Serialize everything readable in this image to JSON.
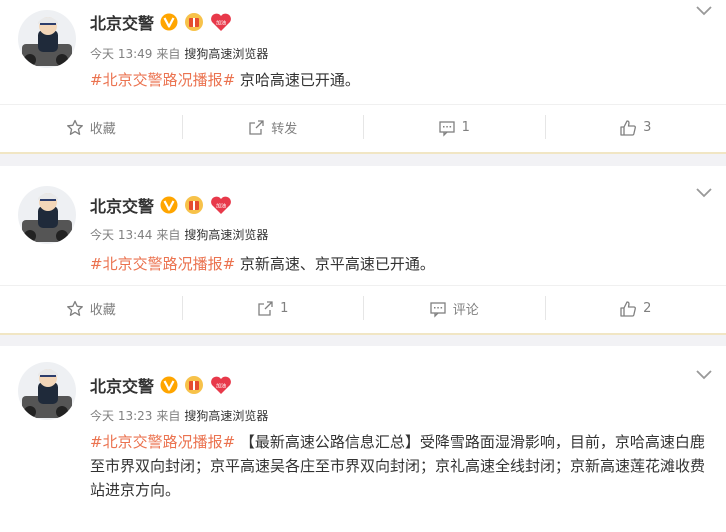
{
  "posts": [
    {
      "author": "北京交警",
      "time": "今天 13:49",
      "via": "来自",
      "source": "搜狗高速浏览器",
      "topic": "#北京交警路况播报#",
      "text": " 京哈高速已开通。",
      "actions": {
        "collect": "收藏",
        "repost": "转发",
        "comment": "1",
        "like": "3"
      }
    },
    {
      "author": "北京交警",
      "time": "今天 13:44",
      "via": "来自",
      "source": "搜狗高速浏览器",
      "topic": "#北京交警路况播报#",
      "text": " 京新高速、京平高速已开通。",
      "actions": {
        "collect": "收藏",
        "repost": "1",
        "comment": "评论",
        "like": "2"
      }
    },
    {
      "author": "北京交警",
      "time": "今天 13:23",
      "via": "来自",
      "source": "搜狗高速浏览器",
      "topic": "#北京交警路况播报#",
      "text": " 【最新高速公路信息汇总】受降雪路面湿滑影响，目前，京哈高速白鹿至市界双向封闭；京平高速吴各庄至市界双向封闭；京礼高速全线封闭；京新高速莲花滩收费站进京方向。"
    }
  ],
  "badges": {
    "heart_label": "加油"
  },
  "colors": {
    "topic": "#eb7350",
    "verified": "#ffa500",
    "heart": "#e8394a"
  }
}
